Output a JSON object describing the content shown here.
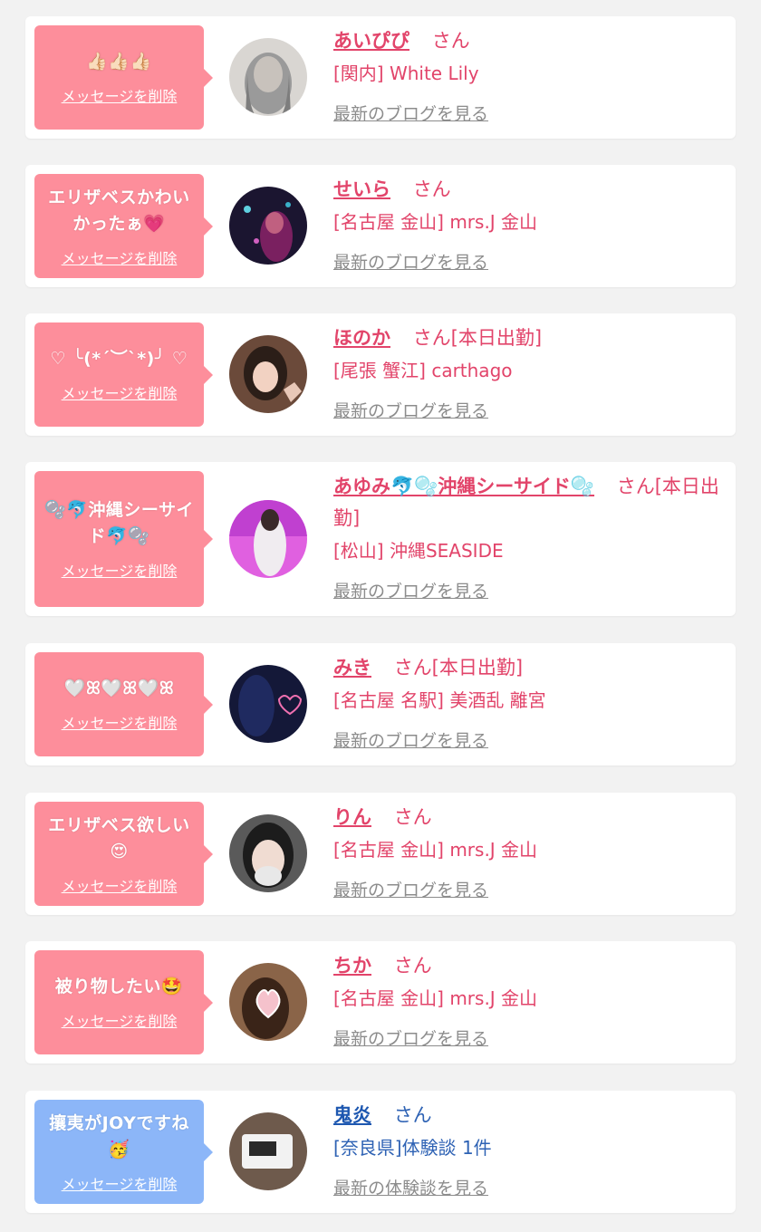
{
  "entries": [
    {
      "message": "👍🏻👍🏻👍🏻",
      "delete_label": "メッセージを削除",
      "name": "あいぴぴ",
      "suffix": "さん",
      "shop": "[関内] White Lily",
      "link_label": "最新のブログを見る",
      "theme": "pink"
    },
    {
      "message": "エリザベスかわいかったぁ💗",
      "delete_label": "メッセージを削除",
      "name": "せいら",
      "suffix": "さん",
      "shop": "[名古屋 金山] mrs.J 金山",
      "link_label": "最新のブログを見る",
      "theme": "pink"
    },
    {
      "message": "♡ ╰(*´︶`*)╯ ♡",
      "delete_label": "メッセージを削除",
      "name": "ほのか",
      "suffix": "さん[本日出勤]",
      "shop": "[尾張 蟹江] carthago",
      "link_label": "最新のブログを見る",
      "theme": "pink"
    },
    {
      "message": "🫧🐬沖縄シーサイド🐬🫧",
      "delete_label": "メッセージを削除",
      "name": "あゆみ🐬🫧沖縄シーサイド🫧",
      "suffix": "さん[本日出勤]",
      "shop": "[松山] 沖縄SEASIDE",
      "link_label": "最新のブログを見る",
      "theme": "pink"
    },
    {
      "message": "🤍ꕤ🤍ꕤ🤍ꕤ",
      "delete_label": "メッセージを削除",
      "name": "みき",
      "suffix": "さん[本日出勤]",
      "shop": "[名古屋 名駅] 美酒乱 離宮",
      "link_label": "最新のブログを見る",
      "theme": "pink"
    },
    {
      "message": "エリザベス欲しい😍",
      "delete_label": "メッセージを削除",
      "name": "りん",
      "suffix": "さん",
      "shop": "[名古屋 金山] mrs.J 金山",
      "link_label": "最新のブログを見る",
      "theme": "pink"
    },
    {
      "message": "被り物したい🤩",
      "delete_label": "メッセージを削除",
      "name": "ちか",
      "suffix": "さん",
      "shop": "[名古屋 金山] mrs.J 金山",
      "link_label": "最新のブログを見る",
      "theme": "pink"
    },
    {
      "message": "攘夷がJOYですね🥳",
      "delete_label": "メッセージを削除",
      "name": "鬼炎",
      "suffix": "さん",
      "shop": "[奈良県]体験談 1件",
      "link_label": "最新の体験談を見る",
      "theme": "blue"
    }
  ]
}
